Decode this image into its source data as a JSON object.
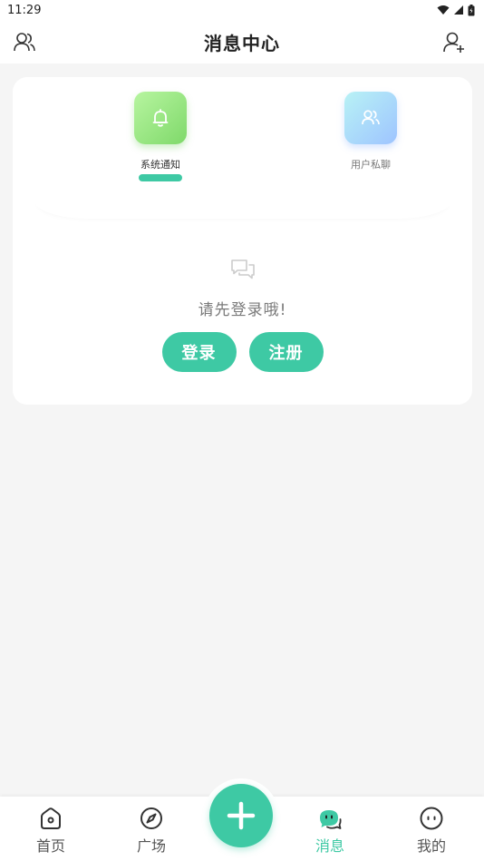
{
  "status_bar": {
    "time": "11:29"
  },
  "header": {
    "title": "消息中心"
  },
  "tabs": [
    {
      "label": "系统通知",
      "icon": "bell-icon",
      "active": true
    },
    {
      "label": "用户私聊",
      "icon": "users-icon",
      "active": false
    }
  ],
  "empty_state": {
    "message": "请先登录哦!",
    "login_label": "登录",
    "register_label": "注册"
  },
  "bottom_nav": {
    "items": [
      {
        "label": "首页",
        "icon": "home-icon"
      },
      {
        "label": "广场",
        "icon": "compass-icon"
      },
      {
        "label": "消息",
        "icon": "chat-icon",
        "active": true
      },
      {
        "label": "我的",
        "icon": "face-icon"
      }
    ]
  },
  "colors": {
    "accent": "#3ec9a4",
    "background": "#f5f5f5",
    "card": "#ffffff"
  }
}
